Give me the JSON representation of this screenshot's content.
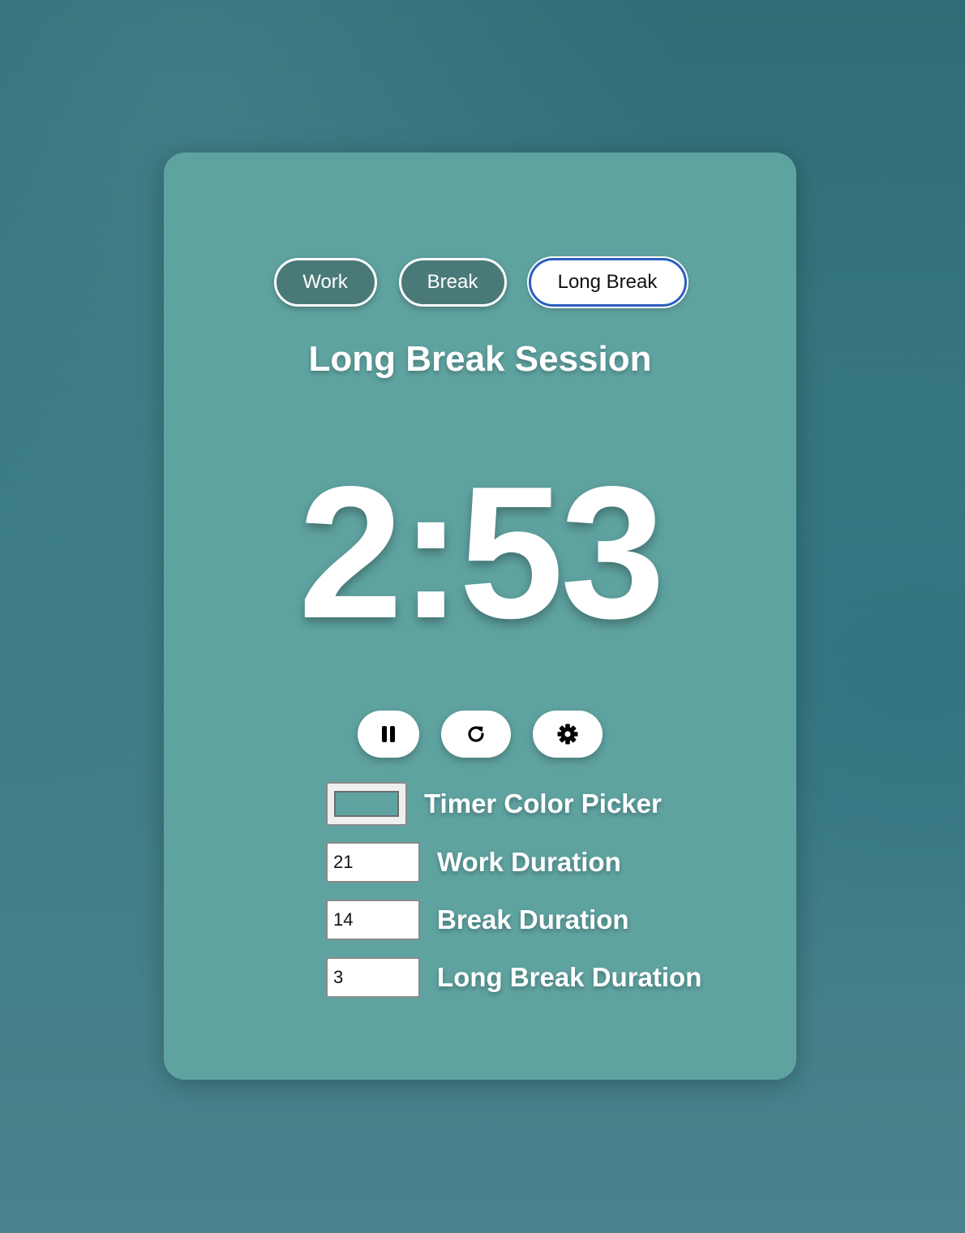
{
  "tabs": [
    {
      "label": "Work",
      "active": false
    },
    {
      "label": "Break",
      "active": false
    },
    {
      "label": "Long Break",
      "active": true
    }
  ],
  "session": {
    "title": "Long Break Session",
    "time": "2:53"
  },
  "controls": {
    "pause_icon": "pause-icon",
    "reset_icon": "reset-icon",
    "settings_icon": "gear-icon"
  },
  "settings": {
    "color_label": "Timer Color Picker",
    "color_value": "#5fa3a1",
    "work_label": "Work Duration",
    "work_value": "21",
    "break_label": "Break Duration",
    "break_value": "14",
    "long_break_label": "Long Break Duration",
    "long_break_value": "3"
  },
  "colors": {
    "card": "#5fa3a1",
    "active_tab_border": "#2a5fc0",
    "inactive_tab": "#4a7a78",
    "background": "#3c7a82"
  }
}
